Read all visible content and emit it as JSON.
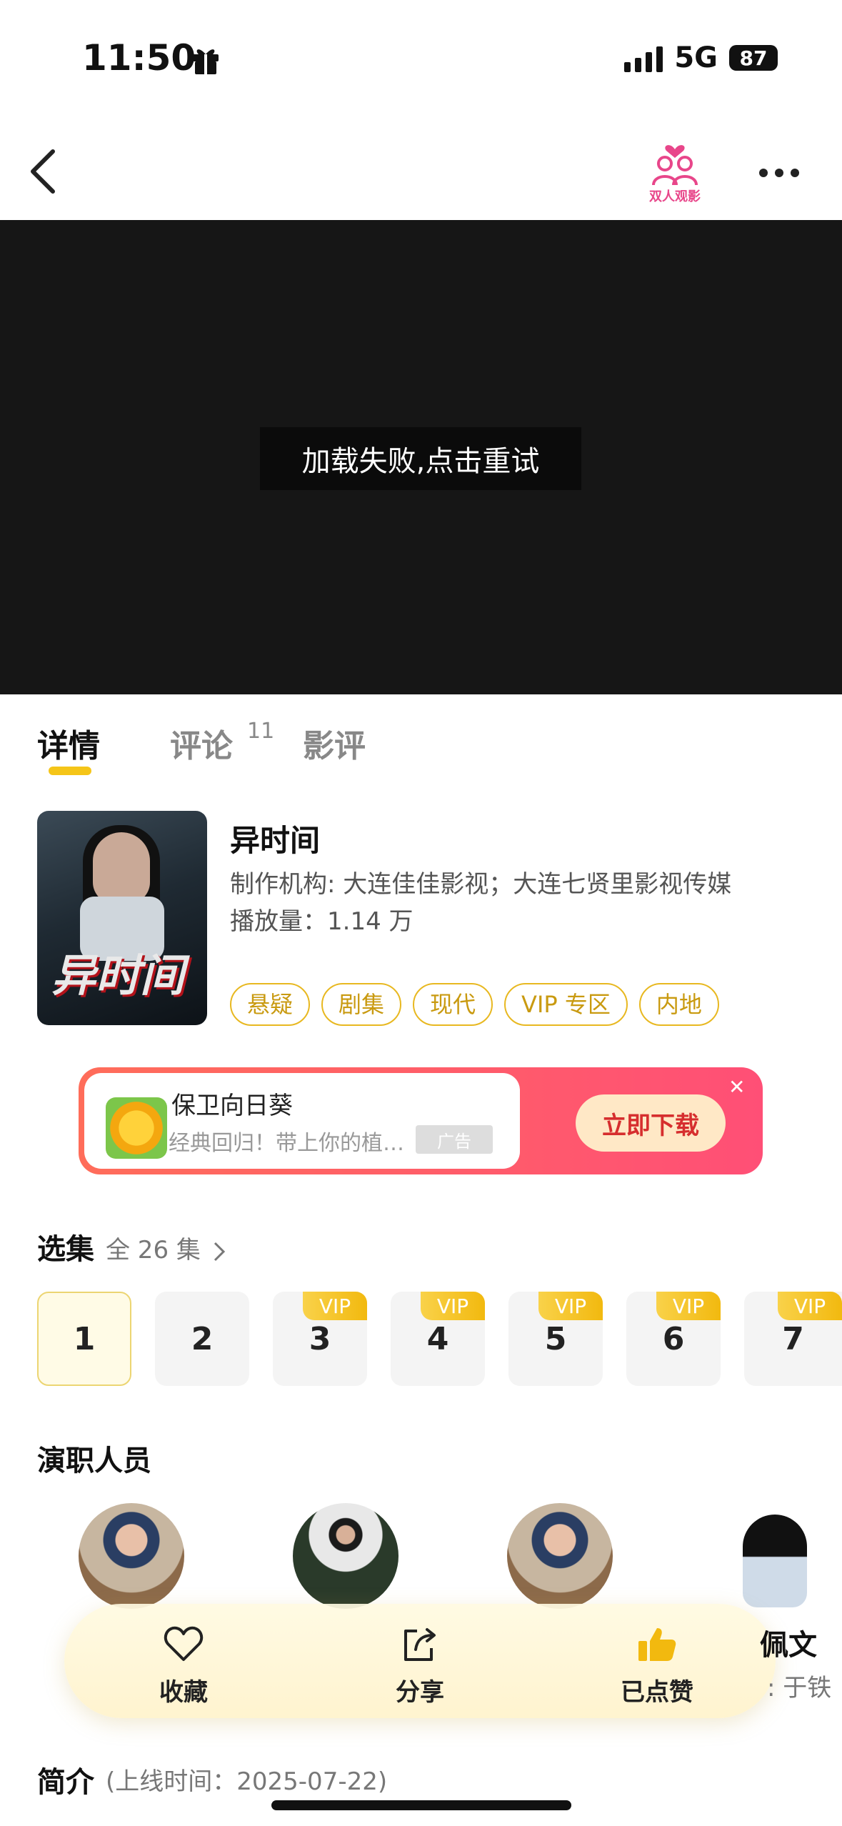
{
  "status_bar": {
    "time": "11:50",
    "network": "5G",
    "battery": "87"
  },
  "nav": {
    "back_icon": "chevron-left-icon",
    "logo_icon": "couple-logo-icon",
    "logo_text": "双人观影",
    "more_icon": "more-dots-icon"
  },
  "player": {
    "error_text": "加载失败,点击重试"
  },
  "tabs": [
    {
      "label": "详情",
      "active": true
    },
    {
      "label": "评论",
      "badge": "11"
    },
    {
      "label": "影评"
    }
  ],
  "show": {
    "title": "异时间",
    "producer": "制作机构: 大连佳佳影视；大连七贤里影视传媒",
    "views": "播放量：1.14 万",
    "tags": [
      "悬疑",
      "剧集",
      "现代",
      "VIP 专区",
      "内地"
    ]
  },
  "ad": {
    "app_name": "保卫向日葵",
    "description": "经典回归！带上你的植…",
    "label": "广告",
    "button": "立即下载",
    "close_icon": "close-icon"
  },
  "episodes": {
    "title": "选集",
    "count": "全 26 集",
    "items": [
      {
        "number": "1",
        "vip": "",
        "selected": true
      },
      {
        "number": "2",
        "vip": ""
      },
      {
        "number": "3",
        "vip": "VIP"
      },
      {
        "number": "4",
        "vip": "VIP"
      },
      {
        "number": "5",
        "vip": "VIP"
      },
      {
        "number": "6",
        "vip": "VIP"
      },
      {
        "number": "7",
        "vip": "VIP"
      }
    ]
  },
  "cast": {
    "title": "演职人员",
    "partial_name": "佩文",
    "partial_role": ": 于铁"
  },
  "actions": [
    {
      "label": "收藏",
      "icon": "heart-icon"
    },
    {
      "label": "分享",
      "icon": "share-icon"
    },
    {
      "label": "已点赞",
      "icon": "thumbs-up-icon"
    }
  ],
  "intro": {
    "title": "简介",
    "date": "(上线时间：2025-07-22)"
  },
  "colors": {
    "accent": "#f5c518",
    "ad_gradient_start": "#ff6d5a",
    "ad_gradient_end": "#ff4f76",
    "logo_pink": "#e8468a"
  }
}
